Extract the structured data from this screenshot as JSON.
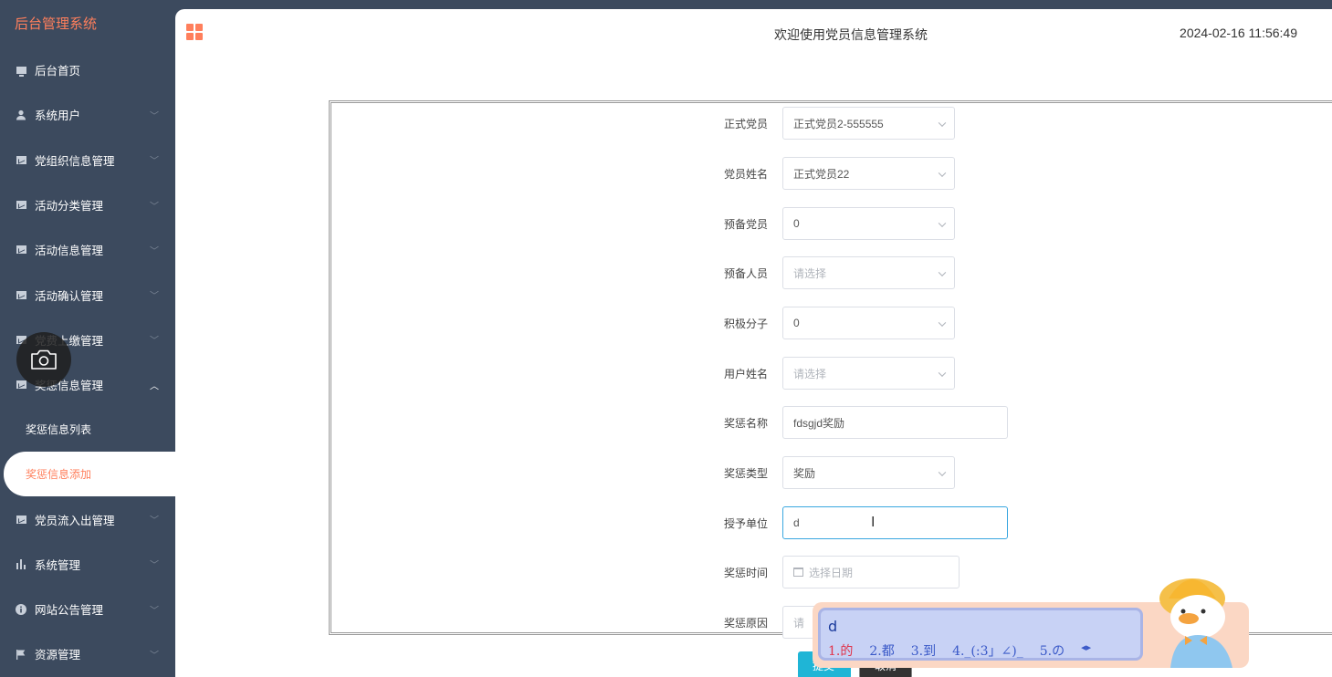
{
  "sidebar": {
    "brand": "后台管理系统",
    "items": [
      {
        "label": "后台首页",
        "icon": "monitor-icon"
      },
      {
        "label": "系统用户",
        "icon": "user-icon"
      },
      {
        "label": "党组织信息管理",
        "icon": "chart-icon"
      },
      {
        "label": "活动分类管理",
        "icon": "chart-icon"
      },
      {
        "label": "活动信息管理",
        "icon": "chart-icon"
      },
      {
        "label": "活动确认管理",
        "icon": "chart-icon"
      },
      {
        "label": "党费上缴管理",
        "icon": "chart-icon"
      },
      {
        "label": "奖惩信息管理",
        "icon": "chart-icon"
      }
    ],
    "sub_items": [
      {
        "label": "奖惩信息列表"
      },
      {
        "label": "奖惩信息添加"
      }
    ],
    "items_after": [
      {
        "label": "党员流入出管理",
        "icon": "chart-icon"
      },
      {
        "label": "系统管理",
        "icon": "bar-chart-icon"
      },
      {
        "label": "网站公告管理",
        "icon": "info-icon"
      },
      {
        "label": "资源管理",
        "icon": "flag-icon"
      }
    ]
  },
  "header": {
    "title": "欢迎使用党员信息管理系统",
    "datetime": "2024-02-16 11:56:49"
  },
  "form": {
    "fields": [
      {
        "label": "正式党员",
        "value": "正式党员2-555555",
        "type": "select"
      },
      {
        "label": "党员姓名",
        "value": "正式党员22",
        "type": "select"
      },
      {
        "label": "预备党员",
        "value": "0",
        "type": "select"
      },
      {
        "label": "预备人员",
        "placeholder": "请选择",
        "type": "select"
      },
      {
        "label": "积极分子",
        "value": "0",
        "type": "select"
      },
      {
        "label": "用户姓名",
        "placeholder": "请选择",
        "type": "select"
      },
      {
        "label": "奖惩名称",
        "value": "fdsgjd奖励",
        "type": "text"
      },
      {
        "label": "奖惩类型",
        "value": "奖励",
        "type": "select"
      },
      {
        "label": "授予单位",
        "value": "d",
        "type": "text"
      },
      {
        "label": "奖惩时间",
        "placeholder": "选择日期",
        "type": "date"
      },
      {
        "label": "奖惩原因",
        "placeholder": "请",
        "type": "text"
      }
    ],
    "submit_label": "提交",
    "cancel_label": "取消"
  },
  "ime": {
    "input": "d",
    "candidates": [
      "1.的",
      "2.都",
      "3.到",
      "4._(:3」∠)_",
      "5.の"
    ]
  },
  "colors": {
    "sidebar_bg": "#3c4a5e",
    "accent": "#ff7f5c",
    "focus_border": "#3aa7e0",
    "submit_bg": "#1fb5d6"
  }
}
